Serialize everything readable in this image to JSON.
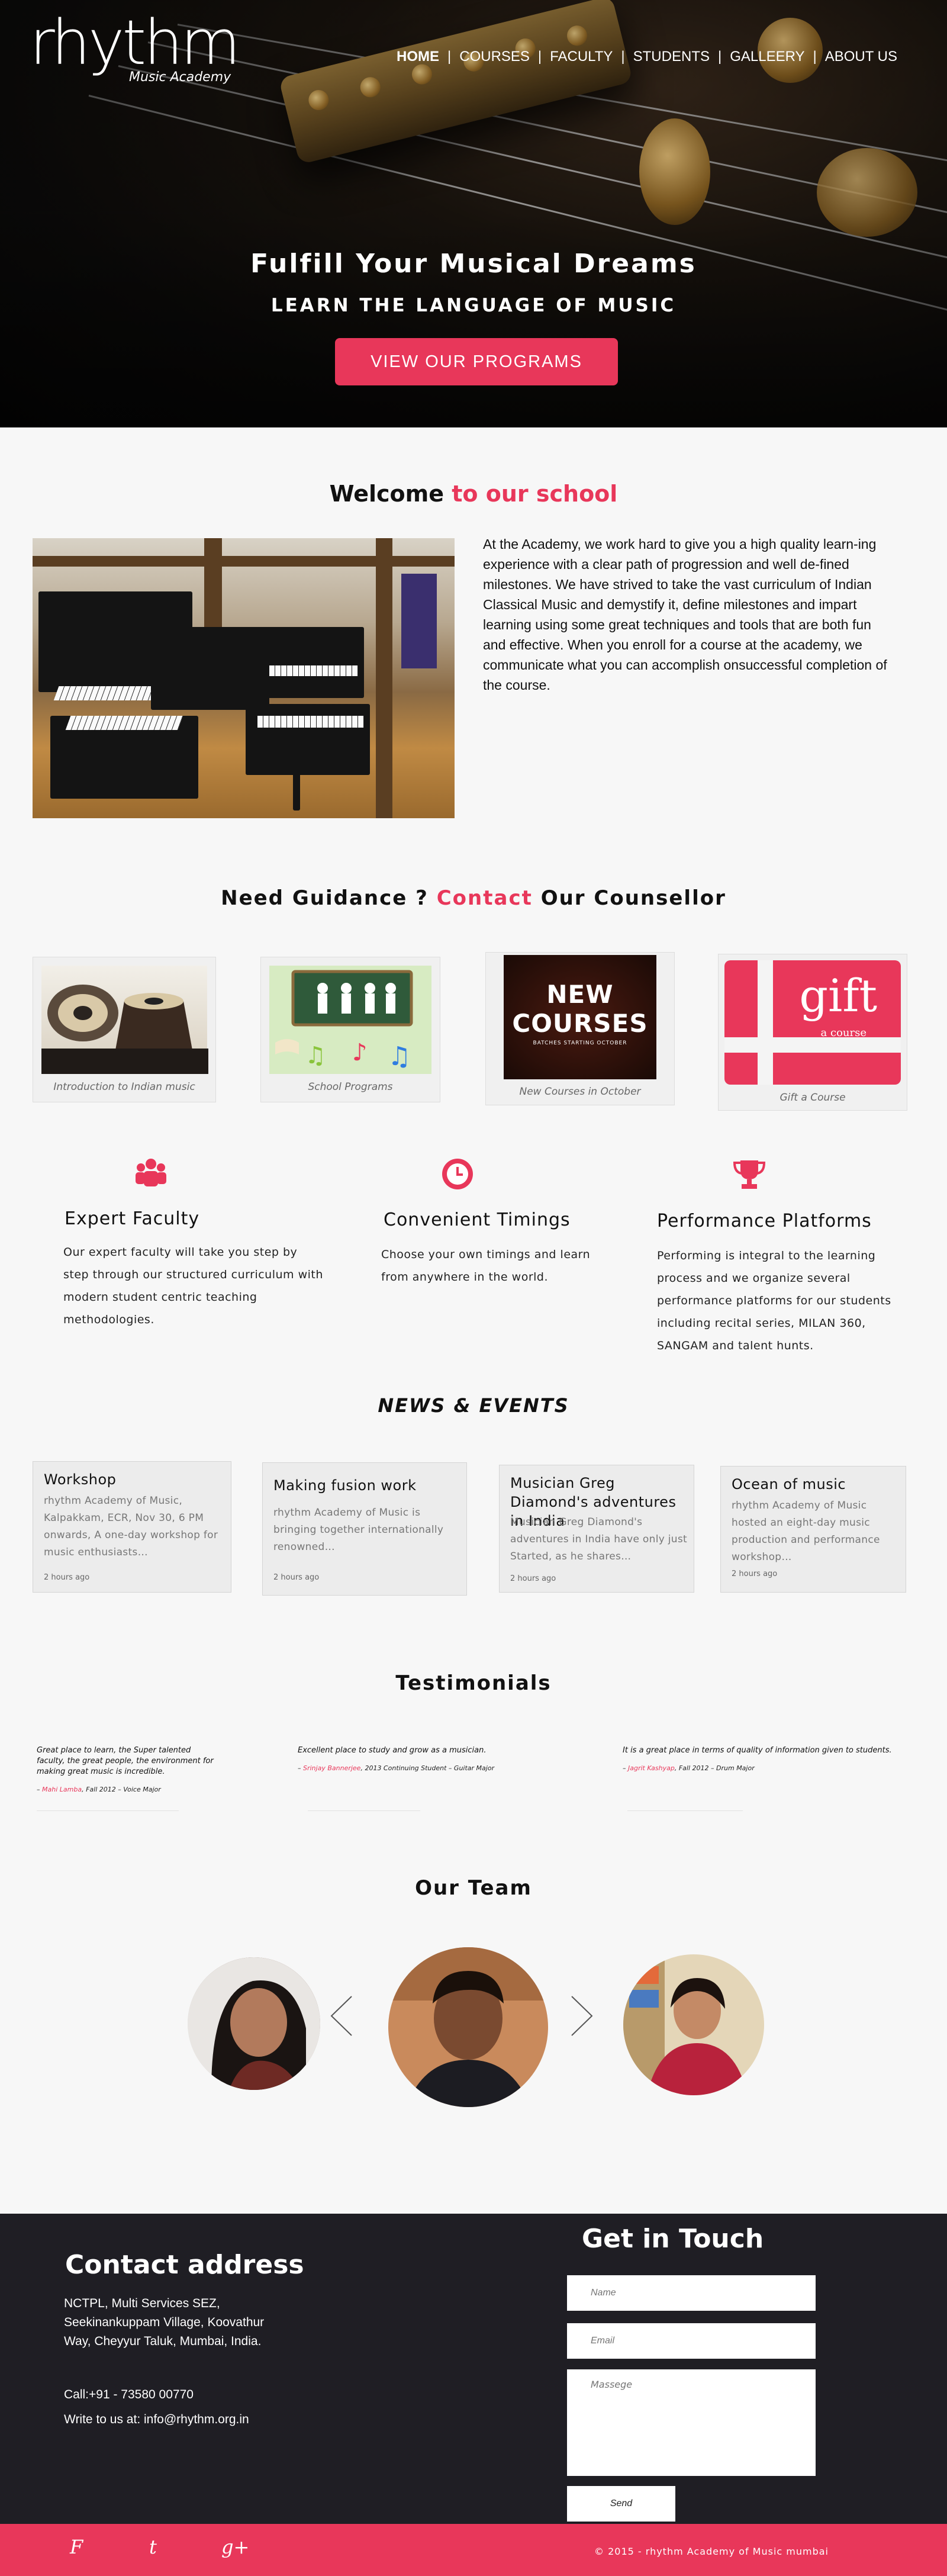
{
  "brand": {
    "logo_word": "rhythm",
    "logo_sub": "Music Academy"
  },
  "nav": {
    "items": [
      "HOME",
      "COURSES",
      "FACULTY",
      "STUDENTS",
      "GALLEERY",
      "ABOUT US"
    ],
    "separator": "|"
  },
  "hero": {
    "title": "Fulfill Your Musical Dreams",
    "subtitle": "LEARN THE LANGUAGE OF MUSIC",
    "cta": "VIEW OUR PROGRAMS"
  },
  "welcome": {
    "title_a": "Welcome",
    "title_b": "to our school",
    "body": "At the Academy, we work hard to give you a high quality learn-ing experience with a clear path of progression and well de-fined milestones. We have strived to take the vast curriculum of Indian Classical Music and demystify it, define milestones and impart learning using some great techniques and tools that are both fun and effective. When you enroll for a course at the academy, we communicate what you can accomplish onsuccessful completion of the course."
  },
  "guidance": {
    "title_a": "Need Guidance ?",
    "title_b": "Contact",
    "title_c": "Our Counsellor"
  },
  "cards": [
    {
      "caption": "Introduction to Indian music"
    },
    {
      "caption": "School Programs"
    },
    {
      "caption": "New Courses in October",
      "img_line1": "NEW",
      "img_line2": "COURSES",
      "img_line3": "BATCHES STARTING OCTOBER"
    },
    {
      "caption": "Gift a Course",
      "img_word": "gift",
      "img_sub": "a course"
    }
  ],
  "features": [
    {
      "icon": "group-icon",
      "title": "Expert Faculty",
      "text": "Our expert faculty will take you step by step through our structured curriculum with modern student centric teaching methodologies."
    },
    {
      "icon": "clock-icon",
      "title": "Convenient Timings",
      "text": "Choose your own timings and learn from anywhere in the world."
    },
    {
      "icon": "trophy-icon",
      "title": "Performance Platforms",
      "text": "Performing is integral to the learning process and we organize several performance platforms for our students including recital series, MILAN 360, SANGAM and talent hunts."
    }
  ],
  "news": {
    "title": "NEWS & EVENTS",
    "items": [
      {
        "title": "Workshop",
        "text": "rhythm Academy of Music, Kalpakkam, ECR, Nov 30, 6 PM onwards, A one-day workshop for music enthusiasts…",
        "time": "2 hours ago"
      },
      {
        "title": "Making fusion work",
        "text": "rhythm Academy of Music is bringing together internationally renowned…",
        "time": "2 hours ago"
      },
      {
        "title": "Musician Greg Diamond's adventures in India",
        "text": "Musician Greg Diamond's adventures in India have only just Started, as he shares…",
        "time": "2 hours ago"
      },
      {
        "title": "Ocean of music",
        "text": "rhythm Academy of Music hosted an eight-day music production and performance workshop…",
        "time": "2 hours ago"
      }
    ]
  },
  "testimonials": {
    "title": "Testimonials",
    "items": [
      {
        "quote": "Great place to learn, the Super talented faculty, the great people, the environment for making great music is incredible.",
        "name": "Mahi Lamba",
        "detail": ", Fall 2012 – Voice Major"
      },
      {
        "quote": "Excellent place to study and grow as a musician.",
        "name": "Srinjay Bannerjee",
        "detail": ", 2013 Continuing Student – Guitar Major"
      },
      {
        "quote": "It is a great place in terms of quality of information given to students.",
        "name": "Jagrit Kashyap",
        "detail": ", Fall 2012 – Drum Major"
      }
    ]
  },
  "team": {
    "title": "Our Team"
  },
  "contact": {
    "title": "Contact address",
    "address": "NCTPL, Multi Services SEZ, Seekinankuppam Village, Koovathur Way, Cheyyur Taluk, Mumbai, India.",
    "call": "Call:+91 - 73580 00770",
    "write": "Write to us at: info@rhythm.org.in"
  },
  "form": {
    "title": "Get in Touch",
    "name_placeholder": "Name",
    "email_placeholder": "Email",
    "message_placeholder": "Massege",
    "send_label": "Send"
  },
  "footer": {
    "social": [
      "F",
      "t",
      "g+"
    ],
    "copyright": "© 2015 - rhythm Academy of Music mumbai"
  },
  "colors": {
    "accent": "#e8375a",
    "footer_bg": "#1f1e24"
  }
}
